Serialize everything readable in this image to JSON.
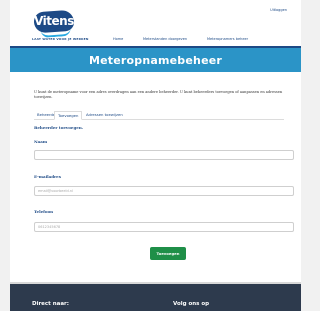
{
  "header": {
    "logo_text": "Vitens",
    "tagline": "LAAT WATER VOOR JE WERKEN",
    "logout": "Uitloggen",
    "nav": [
      "Home",
      "Meterstanden doorgeven",
      "Meteropnamers beheer"
    ]
  },
  "banner": {
    "title": "Meteropnamebeheer"
  },
  "intro": "U kunt de meteropname voor een adres overdragen aan een andere beheerder. U kunt beheerders toevoegen of aanpassen en adressen toewijzen.",
  "tabs": [
    "Beheerders",
    "Toevoegen",
    "Adressen toewijzen"
  ],
  "form": {
    "section_title": "Beheerder toevoegen.",
    "name_label": "Naam",
    "name_value": "",
    "email_label": "E-mailadres",
    "email_placeholder": "email@voorbeeld.nl",
    "phone_label": "Telefoon",
    "phone_placeholder": "0612345678",
    "submit_label": "Toevoegen"
  },
  "footer": {
    "direct": "Direct naar:",
    "follow": "Volg ons op"
  },
  "colors": {
    "brand_blue": "#1d4a86",
    "banner_blue": "#2b94c7",
    "button_green": "#1f8f48",
    "footer_bg": "#2d3a4d"
  }
}
